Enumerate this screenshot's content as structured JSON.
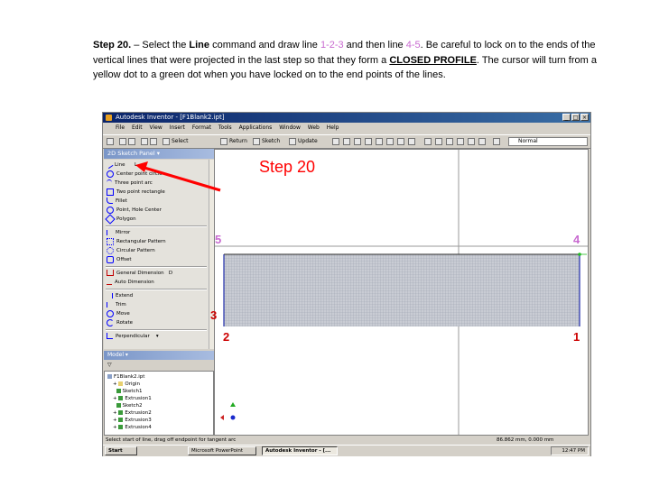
{
  "instructions": {
    "step": "Step 20.",
    "dash": " – Select the ",
    "cmd": "Line",
    "t2": " command and draw line ",
    "l1": "1-2-3",
    "t3": " and then line ",
    "l2": "4-5",
    "t4": ". Be careful to lock on to the ends of the vertical lines that were projected in the last step so that they form a ",
    "closed": "CLOSED PROFILE",
    "t5": ". The cursor will turn from a yellow dot to a green dot when you have locked on to the end points of the lines."
  },
  "app": {
    "title": "Autodesk Inventor - [F1Blank2.ipt]",
    "win_min": "_",
    "win_max": "□",
    "win_close": "×",
    "menu": [
      "File",
      "Edit",
      "View",
      "Insert",
      "Format",
      "Tools",
      "Applications",
      "Window",
      "Web",
      "Help"
    ],
    "toolbar_select": "Select",
    "toolbar_return": "Return",
    "toolbar_sketch": "Sketch",
    "toolbar_update": "Update",
    "style_value": "Normal"
  },
  "panel": {
    "title": "2D Sketch Panel ▾",
    "commands": [
      {
        "label": "Line",
        "color": "#0000ff"
      },
      {
        "label": "Center point circle",
        "color": "#0000ff"
      },
      {
        "label": "Three point arc",
        "color": "#0000ff"
      },
      {
        "label": "Two point rectangle",
        "color": "#0000ff"
      },
      {
        "label": "Fillet",
        "color": "#0000ff"
      },
      {
        "label": "Point, Hole Center",
        "color": "#0000ff"
      },
      {
        "label": "Polygon",
        "color": "#0000ff"
      },
      {
        "label": "Mirror",
        "color": "#0000ff"
      },
      {
        "label": "Rectangular Pattern",
        "color": "#0000ff"
      },
      {
        "label": "Circular Pattern",
        "color": "#0000ff"
      },
      {
        "label": "Offset",
        "color": "#0000ff"
      },
      {
        "label": "General Dimension",
        "color": "#c00000"
      },
      {
        "label": "Auto Dimension",
        "color": "#c00000"
      },
      {
        "label": "Extend",
        "color": "#0000ff"
      },
      {
        "label": "Trim",
        "color": "#0000ff"
      },
      {
        "label": "Move",
        "color": "#0000ff"
      },
      {
        "label": "Rotate",
        "color": "#0000ff"
      },
      {
        "label": "Perpendicular",
        "color": "#0000ff"
      }
    ],
    "shortcut_L": "L",
    "shortcut_D": "D"
  },
  "browser": {
    "title": "Model ▾",
    "filter": "▽",
    "items": [
      "F1Blank2.ipt",
      "Origin",
      "Sketch1",
      "Extrusion1",
      "Sketch2",
      "Extrusion2",
      "Extrusion3",
      "Extrusion4"
    ]
  },
  "status": {
    "left": "Select start of line, drag off endpoint for tangent arc",
    "right": "86.862 mm, 0.000 mm"
  },
  "taskbar": {
    "start": "Start",
    "btn1": "Microsoft PowerPoint",
    "btn2": "Autodesk Inventor - [...",
    "clock": "12:47 PM"
  },
  "annotation": {
    "step_label": "Step 20",
    "p5": "5",
    "p4": "4",
    "p3": "3",
    "p2": "2",
    "p1": "1"
  },
  "colors": {
    "annotation_red": "#ff0000",
    "pink": "#c86ad0",
    "point_label_red": "#cc0000",
    "profile_blue": "#1e2aa8"
  }
}
